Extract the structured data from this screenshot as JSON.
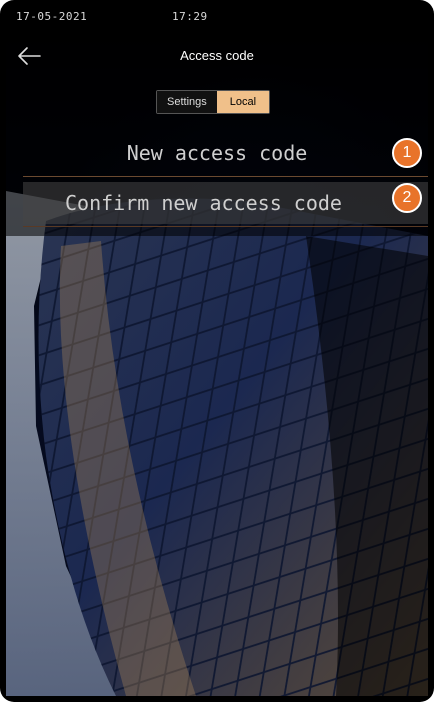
{
  "status_bar": {
    "date": "17-05-2021",
    "time": "17:29"
  },
  "header": {
    "title": "Access code",
    "back_icon": "arrow-left-icon"
  },
  "tabs": [
    {
      "label": "Settings",
      "selected": false
    },
    {
      "label": "Local",
      "selected": true
    }
  ],
  "form": {
    "new_code_placeholder": "New access code",
    "confirm_code_placeholder": "Confirm new access code"
  },
  "callouts": [
    "1",
    "2"
  ],
  "colors": {
    "accent": "#f0c08a",
    "callout": "#e8732a"
  }
}
